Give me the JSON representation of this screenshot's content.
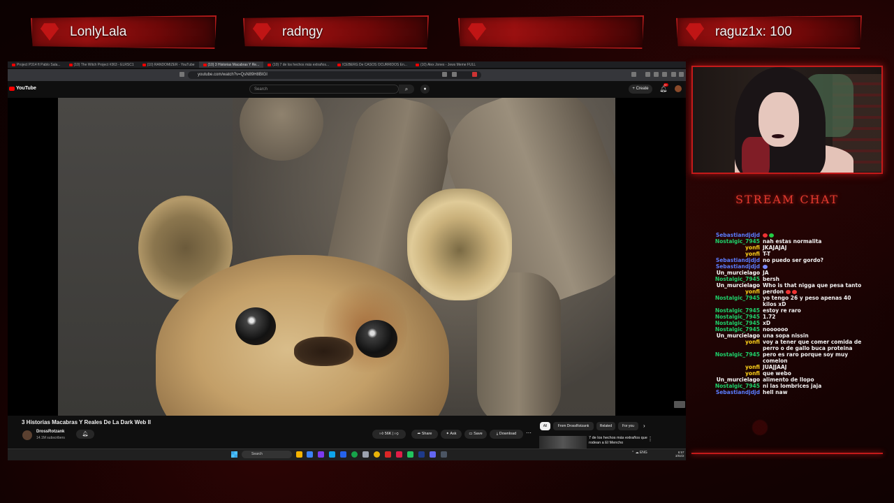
{
  "overlay": {
    "plates": [
      {
        "name": "LonlyLala"
      },
      {
        "name": "radngy"
      },
      {
        "name": ""
      },
      {
        "name": "raguz1x: 100"
      }
    ],
    "chat_title": "STREAM CHAT",
    "accent_color": "#c41a1a"
  },
  "browser": {
    "tabs": [
      {
        "label": "Project P314 ft Pablo Sala..."
      },
      {
        "label": "(10) The Witch Project #363 - ELRSC1"
      },
      {
        "label": "(10) RANDOMIZER - YouTube"
      },
      {
        "label": "(10) 3 Historias Macabras Y Re..."
      },
      {
        "label": "(10) 7 de los hechos más extraños..."
      },
      {
        "label": "ICEBERG De CASOS OCURRIDOS En..."
      },
      {
        "label": "(10) Alex Jones - Jews Meme FULL"
      }
    ],
    "url": "youtube.com/watch?v=QsN89H8BIGI",
    "youtube": {
      "logo": "YouTube",
      "search_placeholder": "Search",
      "create_label": "Create",
      "notification_count": "9+",
      "video_title": "3 Historias Macabras Y Reales De La Dark Web II",
      "channel_name": "DrossRotzank",
      "channel_subs": "14.1M subscribers",
      "actions": {
        "likes": "56K",
        "share": "Share",
        "ask": "Ask",
        "save": "Save",
        "download": "Download"
      },
      "chips": [
        "All",
        "From DrossRotzank",
        "Related",
        "For you"
      ],
      "recommended": {
        "title": "7 de los hechos más extraños que rodean a El Mencho"
      }
    },
    "taskbar": {
      "search": "Search",
      "lang": "ENG",
      "time": "6:57",
      "date": "3/02/2"
    }
  },
  "chat": {
    "messages": [
      {
        "user": "Sebastiandjdjd",
        "text": "",
        "color": "#5b7cff",
        "emotes": [
          "#e33",
          "#2c4"
        ]
      },
      {
        "user": "Nostalgic_7945",
        "text": "nah estas normalita",
        "color": "#1fd06a"
      },
      {
        "user": "yonfi",
        "text": "JKAJAJAJ",
        "color": "#ffd21a"
      },
      {
        "user": "yonfi",
        "text": "T-T",
        "color": "#ffd21a"
      },
      {
        "user": "Sebastiandjdjd",
        "text": "no puedo ser gordo?",
        "color": "#5b7cff"
      },
      {
        "user": "Sebastiandjdjd",
        "text": "",
        "color": "#5b7cff",
        "emotes": [
          "#7a8aff"
        ]
      },
      {
        "user": "Un_murcielago",
        "text": "JA",
        "color": "#ffffff"
      },
      {
        "user": "Nostalgic_7945",
        "text": "bersh",
        "color": "#1fd06a"
      },
      {
        "user": "Un_murcielago",
        "text": "Who is that nigga que pesa tanto",
        "color": "#ffffff"
      },
      {
        "user": "yonfi",
        "text": "perdon",
        "color": "#ffd21a",
        "emotes": [
          "#e33",
          "#e33"
        ]
      },
      {
        "user": "Nostalgic_7945",
        "text": "yo tengo 26 y peso apenas 40 kilos xD",
        "color": "#1fd06a"
      },
      {
        "user": "Nostalgic_7945",
        "text": "estoy re raro",
        "color": "#1fd06a"
      },
      {
        "user": "Nostalgic_7945",
        "text": "1.72",
        "color": "#1fd06a"
      },
      {
        "user": "Nostalgic_7945",
        "text": "xD",
        "color": "#1fd06a"
      },
      {
        "user": "Nostalgic_7945",
        "text": "noooooo",
        "color": "#1fd06a"
      },
      {
        "user": "Un_murcielago",
        "text": "una sopa nissin",
        "color": "#ffffff"
      },
      {
        "user": "yonfi",
        "text": "voy a tener que comer comida de perro o de gallo buca proteina",
        "color": "#ffd21a"
      },
      {
        "user": "Nostalgic_7945",
        "text": "pero es raro porque soy muy comelon",
        "color": "#1fd06a"
      },
      {
        "user": "yonfi",
        "text": "JUAJJAAJ",
        "color": "#ffd21a"
      },
      {
        "user": "yonfi",
        "text": "que webo",
        "color": "#ffd21a"
      },
      {
        "user": "Un_murcielago",
        "text": "alimento de llopo",
        "color": "#ffffff"
      },
      {
        "user": "Nostalgic_7945",
        "text": "ni las lombrices jaja",
        "color": "#1fd06a"
      },
      {
        "user": "Sebastiandjdjd",
        "text": "hell naw",
        "color": "#5b7cff"
      }
    ]
  }
}
